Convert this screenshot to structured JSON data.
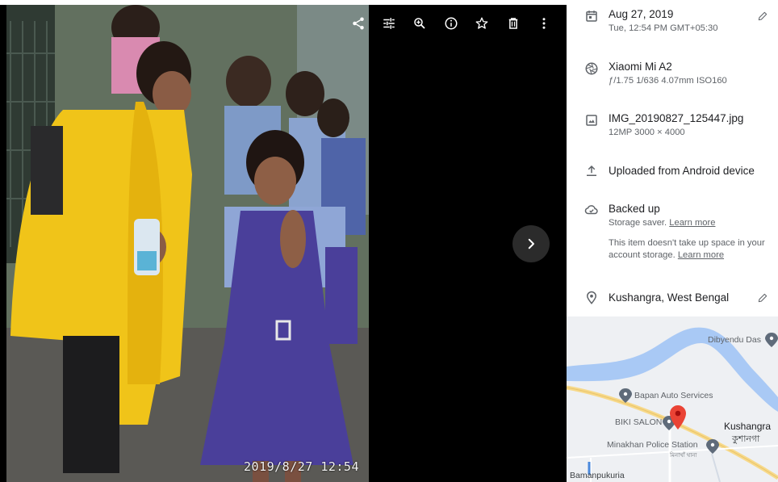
{
  "photo": {
    "timestamp": "2019/8/27  12:54"
  },
  "toolbar": {
    "items": [
      {
        "name": "share-button",
        "icon": "share-icon"
      },
      {
        "name": "edit-button",
        "icon": "tune-icon"
      },
      {
        "name": "zoom-button",
        "icon": "zoom-in-icon"
      },
      {
        "name": "info-button",
        "icon": "info-icon"
      },
      {
        "name": "favorite-button",
        "icon": "star-outline-icon"
      },
      {
        "name": "delete-button",
        "icon": "trash-icon"
      },
      {
        "name": "more-button",
        "icon": "more-vert-icon"
      }
    ]
  },
  "info": {
    "date": {
      "title": "Aug 27, 2019",
      "subtitle": "Tue, 12:54 PM   GMT+05:30"
    },
    "camera": {
      "title": "Xiaomi Mi A2",
      "subtitle": "ƒ/1.75   1/636   4.07mm   ISO160"
    },
    "file": {
      "title": "IMG_20190827_125447.jpg",
      "subtitle": "12MP   3000 × 4000"
    },
    "upload": {
      "title": "Uploaded from Android device"
    },
    "backup": {
      "title": "Backed up",
      "subtitle_prefix": "Storage saver.",
      "subtitle_link": "Learn more",
      "para_text": "This item doesn't take up space in your account storage.",
      "para_link": "Learn more"
    },
    "location": {
      "title": "Kushangra, West Bengal"
    }
  },
  "map": {
    "labels": {
      "dibyendu": "Dibyendu Das",
      "bapan": "Bapan Auto Services",
      "biki": "BIKI SALON",
      "kushangra_en": "Kushangra",
      "kushangra_bn": "কুশানগা",
      "police": "Minakhan Police Station",
      "police_bn": "মিনাখাঁ থানা",
      "bamanpukuria": "Bamanpukuria"
    },
    "colors": {
      "water": "#a9c9f5",
      "road": "#f7d98a",
      "pin": "#ea4335",
      "poi": "#5f6b7a"
    }
  }
}
